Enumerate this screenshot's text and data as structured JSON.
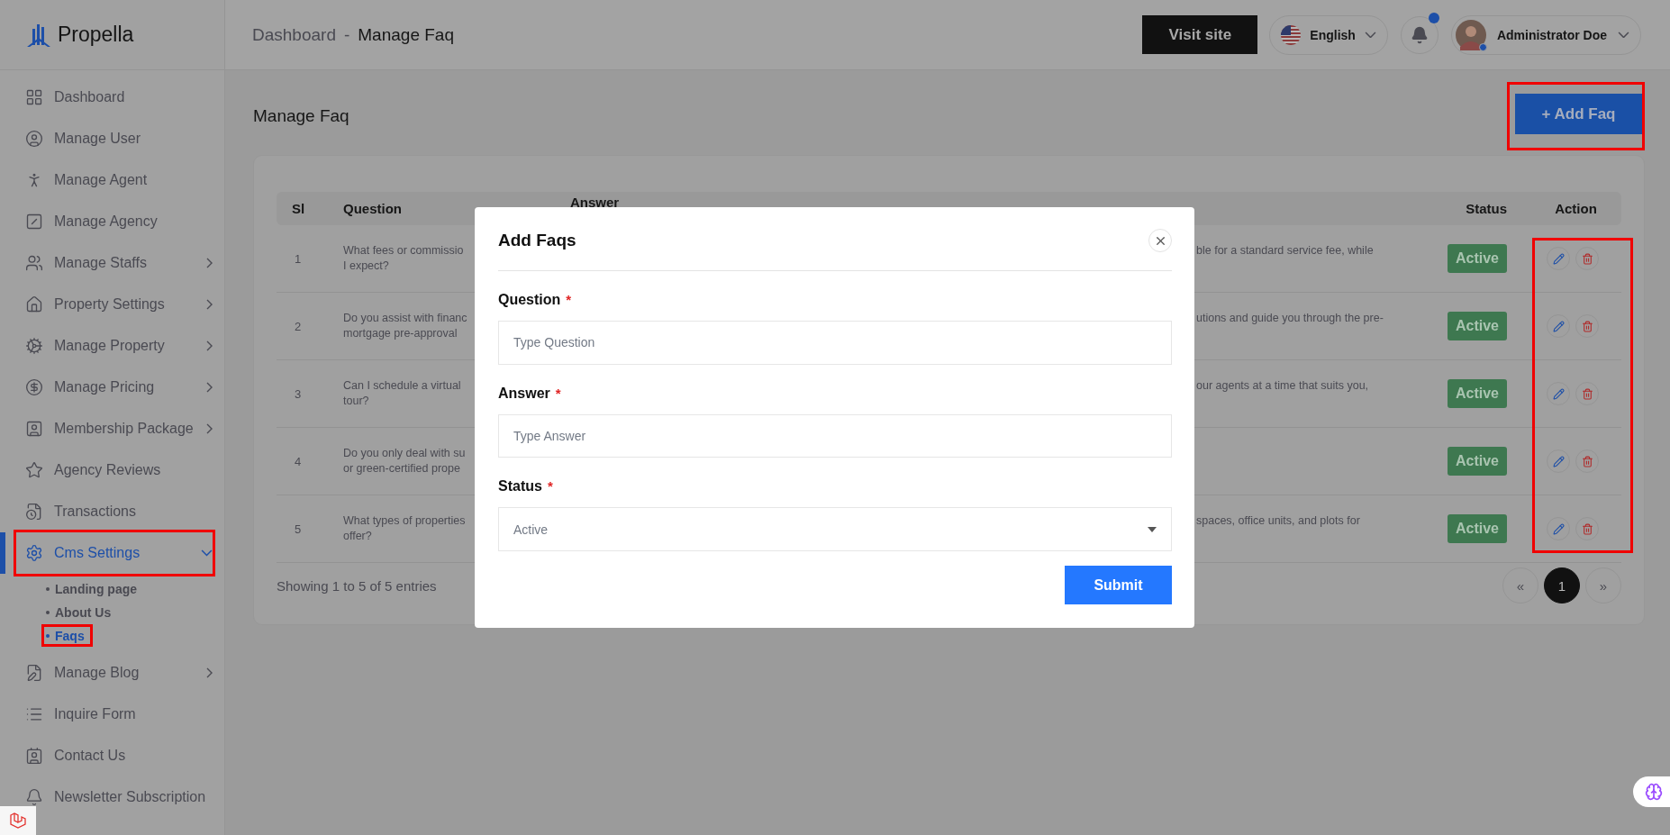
{
  "brand": {
    "name": "Propella"
  },
  "sidebar": {
    "items": [
      {
        "label": "Dashboard",
        "expandable": false,
        "selected": false,
        "highlighted": false
      },
      {
        "label": "Manage User",
        "expandable": false,
        "selected": false,
        "highlighted": false
      },
      {
        "label": "Manage Agent",
        "expandable": false,
        "selected": false,
        "highlighted": false
      },
      {
        "label": "Manage Agency",
        "expandable": false,
        "selected": false,
        "highlighted": false
      },
      {
        "label": "Manage Staffs",
        "expandable": true,
        "expanded": false,
        "selected": false,
        "highlighted": false
      },
      {
        "label": "Property Settings",
        "expandable": true,
        "expanded": false,
        "selected": false,
        "highlighted": false
      },
      {
        "label": "Manage Property",
        "expandable": true,
        "expanded": false,
        "selected": false,
        "highlighted": false
      },
      {
        "label": "Manage Pricing",
        "expandable": true,
        "expanded": false,
        "selected": false,
        "highlighted": false
      },
      {
        "label": "Membership Package",
        "expandable": true,
        "expanded": false,
        "selected": false,
        "highlighted": false
      },
      {
        "label": "Agency Reviews",
        "expandable": false,
        "selected": false,
        "highlighted": false
      },
      {
        "label": "Transactions",
        "expandable": false,
        "selected": false,
        "highlighted": false
      },
      {
        "label": "Cms Settings",
        "expandable": true,
        "expanded": true,
        "selected": true,
        "highlighted": true,
        "children": [
          {
            "label": "Landing page",
            "selected": false,
            "highlighted": false
          },
          {
            "label": "About Us",
            "selected": false,
            "highlighted": false
          },
          {
            "label": "Faqs",
            "selected": true,
            "highlighted": true
          }
        ]
      },
      {
        "label": "Manage Blog",
        "expandable": true,
        "expanded": false,
        "selected": false,
        "highlighted": false
      },
      {
        "label": "Inquire Form",
        "expandable": false,
        "selected": false,
        "highlighted": false
      },
      {
        "label": "Contact Us",
        "expandable": false,
        "selected": false,
        "highlighted": false
      },
      {
        "label": "Newsletter Subscription",
        "expandable": false,
        "selected": false,
        "highlighted": false
      }
    ]
  },
  "header": {
    "breadcrumb": [
      "Dashboard",
      "-",
      "Manage Faq"
    ],
    "visit_button": "Visit site",
    "language": "English",
    "notification": {
      "unread": true
    },
    "user": {
      "name": "Administrator Doe",
      "online": true
    }
  },
  "page": {
    "title": "Manage Faq",
    "add_button": {
      "label": "+ Add Faq",
      "highlighted": true
    }
  },
  "table": {
    "columns": [
      "Sl",
      "Question",
      "Answer",
      "Status",
      "Action"
    ],
    "rows": [
      {
        "sl": "1",
        "question": "What fees or commissio\nI expect?",
        "answer": "ble for a standard service fee, while",
        "status": "Active"
      },
      {
        "sl": "2",
        "question": "Do you assist with financ\nmortgage pre-approval",
        "answer": "utions and guide you through the pre-",
        "status": "Active"
      },
      {
        "sl": "3",
        "question": "Can I schedule a virtual\ntour?",
        "answer": "our agents at a time that suits you,",
        "status": "Active"
      },
      {
        "sl": "4",
        "question": "Do you only deal with su\nor green-certified prope",
        "status": "Active"
      },
      {
        "sl": "5",
        "question": "What types of properties\noffer?",
        "answer": "spaces, office units, and plots for",
        "status": "Active"
      }
    ],
    "actions_highlighted": true,
    "footer": "Showing 1 to 5 of 5 entries",
    "pagination": [
      {
        "label": "«",
        "selected": false
      },
      {
        "label": "1",
        "selected": true
      },
      {
        "label": "»",
        "selected": false
      }
    ]
  },
  "modal": {
    "title": "Add Faqs",
    "fields": [
      {
        "kind": "text",
        "label": "Question",
        "required_mark": "*",
        "placeholder": "Type Question"
      },
      {
        "kind": "text",
        "label": "Answer",
        "required_mark": "*",
        "placeholder": "Type Answer"
      },
      {
        "kind": "select",
        "label": "Status",
        "required_mark": "*",
        "value": "Active"
      }
    ],
    "submit": "Submit"
  }
}
